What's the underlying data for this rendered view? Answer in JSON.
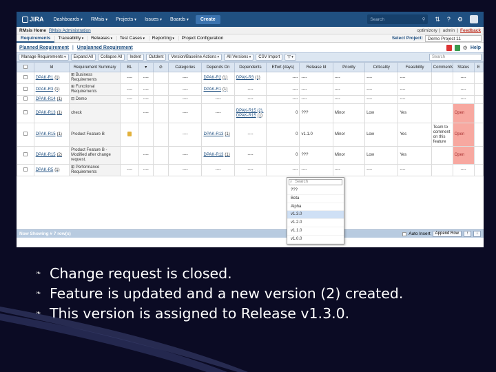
{
  "jira": {
    "logo": "JIRA",
    "nav": [
      "Dashboards",
      "RMsis",
      "Projects",
      "Issues",
      "Boards"
    ],
    "create_label": "Create",
    "search_placeholder": "Search"
  },
  "rmsis_bar": {
    "home": "RMsis Home",
    "admin": "RMsis Administration",
    "right_items": [
      "optimizory",
      "admin"
    ],
    "feedback": "Feedback"
  },
  "menu_bar": {
    "requirements_tab": "Requirements",
    "menus": [
      "Traceability",
      "Releases",
      "Test Cases",
      "Reporting"
    ],
    "project_config": "Project Configuration",
    "select_project_label": "Select Project:",
    "project_value": "Demo Project 11"
  },
  "view_tabs": {
    "planned": "Planned Requirement",
    "separator": "|",
    "unplanned": "Unplanned Requirement",
    "help": "Help"
  },
  "toolbar": {
    "manage": "Manage Requirements",
    "expand_all": "Expand All",
    "collapse_all": "Collapse All",
    "indent": "Indent",
    "outdent": "Outdent",
    "version_baseline": "Version/Baseline Actions",
    "all_versions": "All Versions",
    "csv_import": "CSV Import",
    "search_placeholder": "Search"
  },
  "grid": {
    "headers": [
      "Id",
      "Requirement Summary",
      "BL",
      "Categories",
      "Depends On",
      "Dependents",
      "Effort (days)",
      "Release Id",
      "Priority",
      "Criticality",
      "Feasibility",
      "Comments",
      "Status"
    ],
    "rows": [
      {
        "id": "DPAK-R1",
        "ver": "(1)",
        "summary": "⊞ Business Requirements",
        "bl": "----",
        "att": "----",
        "cat": "----",
        "depends": "DPAK-R2",
        "depends_v": "(1)",
        "dependents": "DPAK-R3",
        "dependents_v": "(1)",
        "effort": "----",
        "release": "----",
        "priority": "----",
        "criticality": "----",
        "feasibility": "----",
        "comments": "",
        "status": "----"
      },
      {
        "id": "DPAK-R3",
        "ver": "(1)",
        "summary": "⊞ Functional Requirements",
        "bl": "----",
        "att": "----",
        "cat": "----",
        "depends": "DPAK-R1",
        "depends_v": "(1)",
        "dependents": "----",
        "dependents_v": "",
        "effort": "----",
        "release": "----",
        "priority": "----",
        "criticality": "----",
        "feasibility": "----",
        "comments": "",
        "status": "----"
      },
      {
        "id": "DPAK-R14",
        "ver": "(1)",
        "summary": "⊟ Demo",
        "bl": "----",
        "att": "----",
        "cat": "----",
        "depends": "----",
        "depends_v": "",
        "dependents": "----",
        "dependents_v": "",
        "effort": "----",
        "release": "----",
        "priority": "----",
        "criticality": "----",
        "feasibility": "----",
        "comments": "",
        "status": "----"
      },
      {
        "id": "DPAK-R13",
        "ver": "(1)",
        "summary": "check",
        "bl": "",
        "att": "----",
        "cat": "----",
        "depends": "----",
        "depends_v": "",
        "dependents": "DPAK-R15 (2), DPAK-R15",
        "dependents_v": "(1)",
        "effort": "0",
        "release": "???",
        "priority": "Minor",
        "criticality": "Low",
        "feasibility": "Yes",
        "comments": "",
        "status": "Open"
      },
      {
        "id": "DPAK-R15",
        "ver": "(1)",
        "summary": "Product Feature B",
        "bl": "lock",
        "att": "",
        "cat": "----",
        "depends": "DPAK-R13",
        "depends_v": "(1)",
        "dependents": "----",
        "dependents_v": "",
        "effort": "0",
        "release": "v1.1.0",
        "priority": "Minor",
        "criticality": "Low",
        "feasibility": "Yes",
        "comments": "Team to comment on this feature",
        "status": "Open"
      },
      {
        "id": "DPAK-R15",
        "ver": "(2)",
        "summary": "Product Feature B - Modified after change request.",
        "bl": "",
        "att": "----",
        "cat": "----",
        "depends": "DPAK-R13",
        "depends_v": "(1)",
        "dependents": "----",
        "dependents_v": "",
        "effort": "0",
        "release": "???",
        "priority": "Minor",
        "criticality": "Low",
        "feasibility": "Yes",
        "comments": "",
        "status": "Open"
      },
      {
        "id": "DPAK-R5",
        "ver": "(1)",
        "summary": "⊞ Performance Requirements",
        "bl": "----",
        "att": "----",
        "cat": "----",
        "depends": "----",
        "depends_v": "",
        "dependents": "----",
        "dependents_v": "",
        "effort": "----",
        "release": "----",
        "priority": "----",
        "criticality": "----",
        "feasibility": "----",
        "comments": "",
        "status": "----"
      }
    ]
  },
  "status_bar": {
    "showing": "Now Showing # 7 row(s)",
    "auto_insert": "Auto Insert",
    "append_row": "Append Row"
  },
  "release_dropdown": {
    "search_placeholder": "Search",
    "options": [
      "???",
      "Beta",
      "Alpha",
      "v1.3.0",
      "v1.2.0",
      "v1.1.0",
      "v1.0.0"
    ],
    "selected": "v1.3.0"
  },
  "bullets": [
    "Change request is closed.",
    "Feature is updated and a new version (2) created.",
    "This version is assigned to Release v1.3.0."
  ],
  "colors": {
    "jira_blue": "#205081",
    "status_open": "#f7a8a0",
    "background": "#0b0b24"
  }
}
